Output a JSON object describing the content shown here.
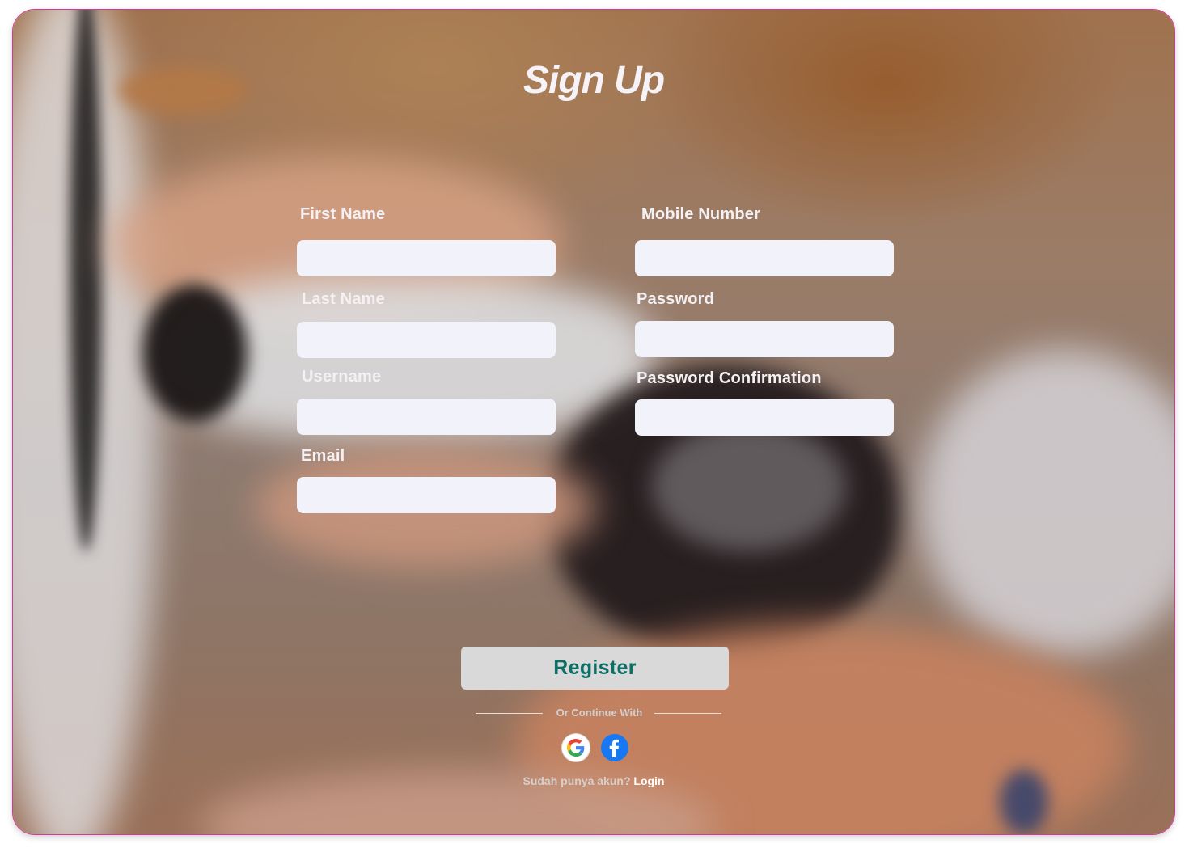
{
  "page": {
    "title": "Sign Up"
  },
  "form": {
    "fields": [
      {
        "label": "First Name",
        "value": "",
        "placeholder": ""
      },
      {
        "label": "Last Name",
        "value": "",
        "placeholder": ""
      },
      {
        "label": "Username",
        "value": "",
        "placeholder": ""
      },
      {
        "label": "Email",
        "value": "",
        "placeholder": ""
      },
      {
        "label": "Mobile Number",
        "value": "",
        "placeholder": ""
      },
      {
        "label": "Password",
        "value": "",
        "placeholder": ""
      },
      {
        "label": "Password Confirmation",
        "value": "",
        "placeholder": ""
      }
    ],
    "register_label": "Register"
  },
  "social": {
    "divider_text": "Or Continue With",
    "providers": [
      {
        "name": "Google",
        "icon": "google-icon"
      },
      {
        "name": "Facebook",
        "icon": "facebook-icon",
        "color": "#1877f2"
      }
    ]
  },
  "footer": {
    "prompt": "Sudah punya akun?",
    "login_label": "Login"
  },
  "colors": {
    "frame_border": "#d4389a",
    "input_bg": "#f2f2fb",
    "register_bg": "#d9d9d9",
    "register_text": "#0d6f66"
  }
}
